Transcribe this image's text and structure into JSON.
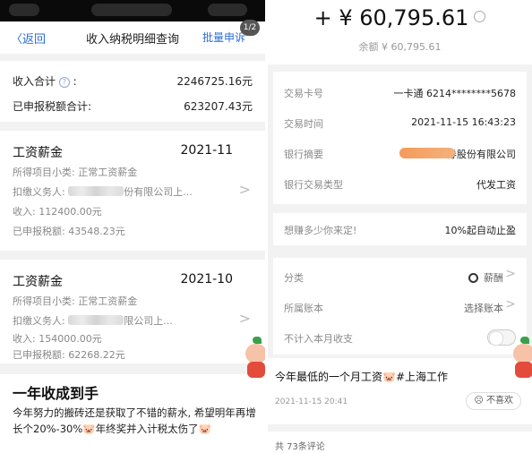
{
  "left": {
    "nav": {
      "back": "〈返回",
      "title": "收入纳税明细查询",
      "batch": "批量申诉",
      "page_badge": "1/2"
    },
    "summary": {
      "income_label": "收入合计",
      "income_value": "2246725.16元",
      "tax_label": "已申报税额合计:",
      "tax_value": "623207.43元"
    },
    "records": [
      {
        "title": "工资薪金",
        "period": "2021-11",
        "item_line": "所得项目小类: 正常工资薪金",
        "payer_prefix": "扣缴义务人: ",
        "payer_suffix": "份有限公司上...",
        "income_line": "收入: 112400.00元",
        "tax_line": "已申报税额: 43548.23元"
      },
      {
        "title": "工资薪金",
        "period": "2021-10",
        "item_line": "所得项目小类: 正常工资薪金",
        "payer_prefix": "扣缴义务人: ",
        "payer_suffix": "限公司上...",
        "income_line": "收入: 154000.00元",
        "tax_line": "已申报税额: 62268.22元"
      }
    ],
    "post": {
      "title": "一年收成到手",
      "body": "今年努力的搬砖还是获取了不错的薪水, 希望明年再增长个20%-30%🐷年终奖并入计税太伤了🐷"
    }
  },
  "right": {
    "amount": "+ ¥ 60,795.61",
    "balance": "余额 ¥ 60,795.61",
    "details": [
      {
        "key": "交易卡号",
        "value": "一卡通 6214********5678"
      },
      {
        "key": "交易时间",
        "value": "2021-11-15 16:43:23"
      },
      {
        "key": "银行摘要",
        "value": "证券股份有限公司"
      },
      {
        "key": "银行交易类型",
        "value": "代发工资"
      }
    ],
    "promo": {
      "key": "想赚多少你来定!",
      "value": "10%起自动止盈"
    },
    "category": {
      "key": "分类",
      "value": "薪酬"
    },
    "account": {
      "key": "所属账本",
      "value": "选择账本"
    },
    "exclude": {
      "key": "不计入本月收支"
    },
    "post": {
      "title": "今年最低的一个月工资🐷#上海工作",
      "date": "2021-11-15 20:41",
      "dislike": "不喜欢",
      "comments": "共 73条评论"
    }
  },
  "colors": {
    "link_blue": "#2d6ed6",
    "accent_red": "#e84545",
    "smear_orange": "#f59a59"
  }
}
